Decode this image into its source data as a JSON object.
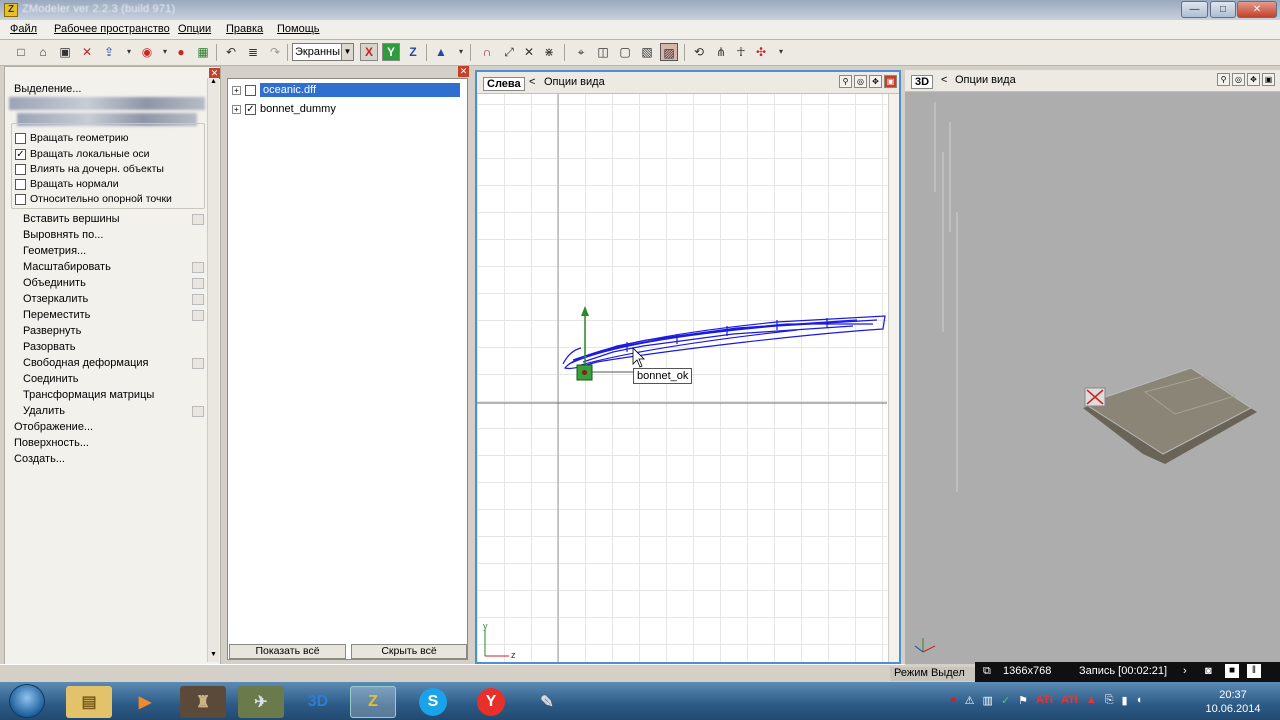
{
  "app": {
    "title": "ZModeler ver 2.2.3 (build 971)"
  },
  "window_buttons": {
    "minimize": "—",
    "maximize": "□",
    "close": "✕"
  },
  "menu": [
    "Файл",
    "Рабочее пространство",
    "Опции",
    "Правка",
    "Помощь"
  ],
  "toolbar": {
    "view_mode": "Экранны",
    "axis_x": "X",
    "axis_y": "Y",
    "axis_z": "Z"
  },
  "left_panel": {
    "close": "✕",
    "selection_header": "Выделение...",
    "options": [
      {
        "label": "Вращать геометрию",
        "checked": false
      },
      {
        "label": "Вращать локальные оси",
        "checked": true
      },
      {
        "label": "Влиять на дочерн. объекты",
        "checked": false
      },
      {
        "label": "Вращать нормали",
        "checked": false
      },
      {
        "label": "Относительно опорной точки",
        "checked": false
      }
    ],
    "commands": [
      {
        "label": "Вставить вершины",
        "box": true
      },
      {
        "label": "Выровнять по...",
        "box": false
      },
      {
        "label": "Геометрия...",
        "box": false
      },
      {
        "label": "Масштабировать",
        "box": true
      },
      {
        "label": "Объединить",
        "box": true
      },
      {
        "label": "Отзеркалить",
        "box": true
      },
      {
        "label": "Переместить",
        "box": true
      },
      {
        "label": "Развернуть",
        "box": false
      },
      {
        "label": "Разорвать",
        "box": false
      },
      {
        "label": "Свободная деформация",
        "box": true
      },
      {
        "label": "Соединить",
        "box": false
      },
      {
        "label": "Трансформация матрицы",
        "box": false
      },
      {
        "label": "Удалить",
        "box": true
      }
    ],
    "sections": [
      "Отображение...",
      "Поверхность...",
      "Создать..."
    ]
  },
  "tree": {
    "close": "✕",
    "items": [
      {
        "label": "oceanic.dff",
        "checked": false,
        "selected": true
      },
      {
        "label": "bonnet_dummy",
        "checked": true,
        "selected": false
      }
    ],
    "show_all": "Показать всё",
    "hide_all": "Скрыть всё"
  },
  "viewport_left": {
    "name": "Слева",
    "options": "Опции вида",
    "object_tooltip": "bonnet_ok",
    "axis_y": "y",
    "axis_z": "z"
  },
  "viewport_3d": {
    "name": "3D",
    "options": "Опции вида"
  },
  "status": {
    "mode_text": "Режим Выдел"
  },
  "recorder": {
    "resolution": "1366x768",
    "record": "Запись [00:02:21]"
  },
  "clock": {
    "time": "20:37",
    "date": "10.06.2014"
  },
  "taskbar_apps": [
    "start-orb",
    "folder",
    "media",
    "game",
    "app-4",
    "3d",
    "zmodeler",
    "skype",
    "yandex",
    "tool"
  ]
}
